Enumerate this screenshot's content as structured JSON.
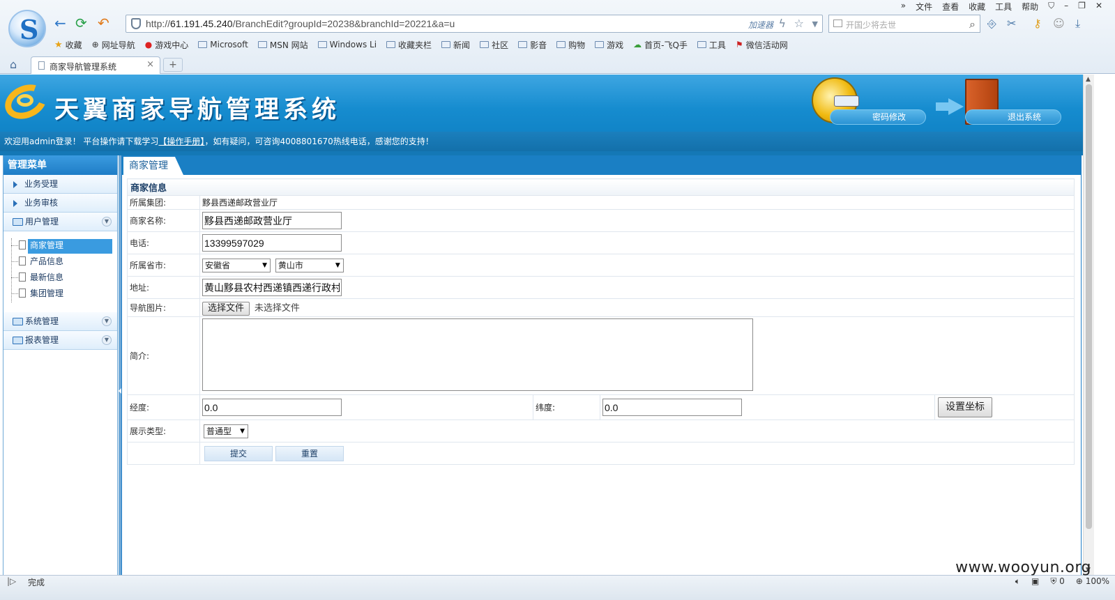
{
  "browser": {
    "menu": [
      "»",
      "文件",
      "查看",
      "收藏",
      "工具",
      "帮助"
    ],
    "url_prefix": "http://",
    "url_host": "61.191.45.240",
    "url_path": "/BranchEdit?groupId=20238&branchId=20221&a=u",
    "accelerator_label": "加速器",
    "search_placeholder": "开国少将去世",
    "bookmarks": [
      "收藏",
      "网址导航",
      "游戏中心",
      "Microsoft",
      "MSN 网站",
      "Windows Li",
      "收藏夹栏",
      "新闻",
      "社区",
      "影音",
      "购物",
      "游戏",
      "首页-飞Q手",
      "工具",
      "微信活动网"
    ],
    "tab_title": "商家导航管理系统",
    "new_tab": "+",
    "close_tab": "×"
  },
  "header": {
    "system_title": "天翼商家导航管理系统",
    "change_password": "密码修改",
    "exit": "退出系统",
    "welcome": "欢迎用admin登录！ 平台操作请下载学习",
    "manual_link": "【操作手册】",
    "welcome_tail": "，如有疑问，可咨询4008801670热线电话，感谢您的支持！"
  },
  "sidebar": {
    "title": "管理菜单",
    "items_top": [
      "业务受理",
      "业务审核"
    ],
    "user_group": "用户管理",
    "sub_items": [
      "商家管理",
      "产品信息",
      "最新信息",
      "集团管理"
    ],
    "active_sub": "商家管理",
    "groups_bottom": [
      "系统管理",
      "报表管理"
    ]
  },
  "main": {
    "tab": "商家管理",
    "section_title": "商家信息",
    "fields": {
      "group_label": "所属集团:",
      "group_value": "黟县西递邮政营业厅",
      "name_label": "商家名称:",
      "name_value": "黟县西递邮政营业厅",
      "phone_label": "电话:",
      "phone_value": "13399597029",
      "region_label": "所属省市:",
      "province": "安徽省",
      "city": "黄山市",
      "address_label": "地址:",
      "address_value": "黄山黟县农村西递镇西递行政村/",
      "image_label": "导航图片:",
      "file_button": "选择文件",
      "file_none": "未选择文件",
      "intro_label": "简介:",
      "lng_label": "经度:",
      "lng_value": "0.0",
      "lat_label": "纬度:",
      "lat_value": "0.0",
      "set_coord": "设置坐标",
      "display_label": "展示类型:",
      "display_value": "普通型"
    },
    "submit": "提交",
    "reset": "重置"
  },
  "status": {
    "text": "完成",
    "zoom": "100%",
    "count": "0"
  },
  "watermark": "www.wooyun.org"
}
